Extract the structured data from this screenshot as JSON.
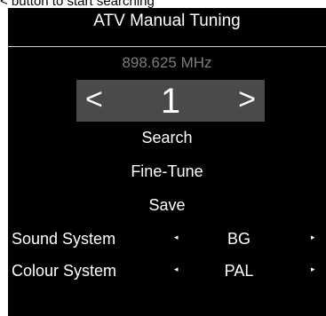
{
  "caption": "< button to start searching",
  "panel": {
    "title": "ATV Manual Tuning",
    "frequency": "898.625 MHz",
    "channel": {
      "number": "1",
      "prev_glyph": "<",
      "next_glyph": ">"
    },
    "menu": {
      "search": "Search",
      "fine_tune": "Fine-Tune",
      "save": "Save"
    },
    "settings": [
      {
        "label": "Sound System",
        "value": "BG",
        "left_arrow": "◂",
        "right_arrow": "▸"
      },
      {
        "label": "Colour System",
        "value": "PAL",
        "left_arrow": "◂",
        "right_arrow": "▸"
      }
    ]
  },
  "colors": {
    "panel_bg": "#000000",
    "selected_bg": "#4a4a4a",
    "frequency_text": "#7d7d7d",
    "text": "#ffffff"
  }
}
